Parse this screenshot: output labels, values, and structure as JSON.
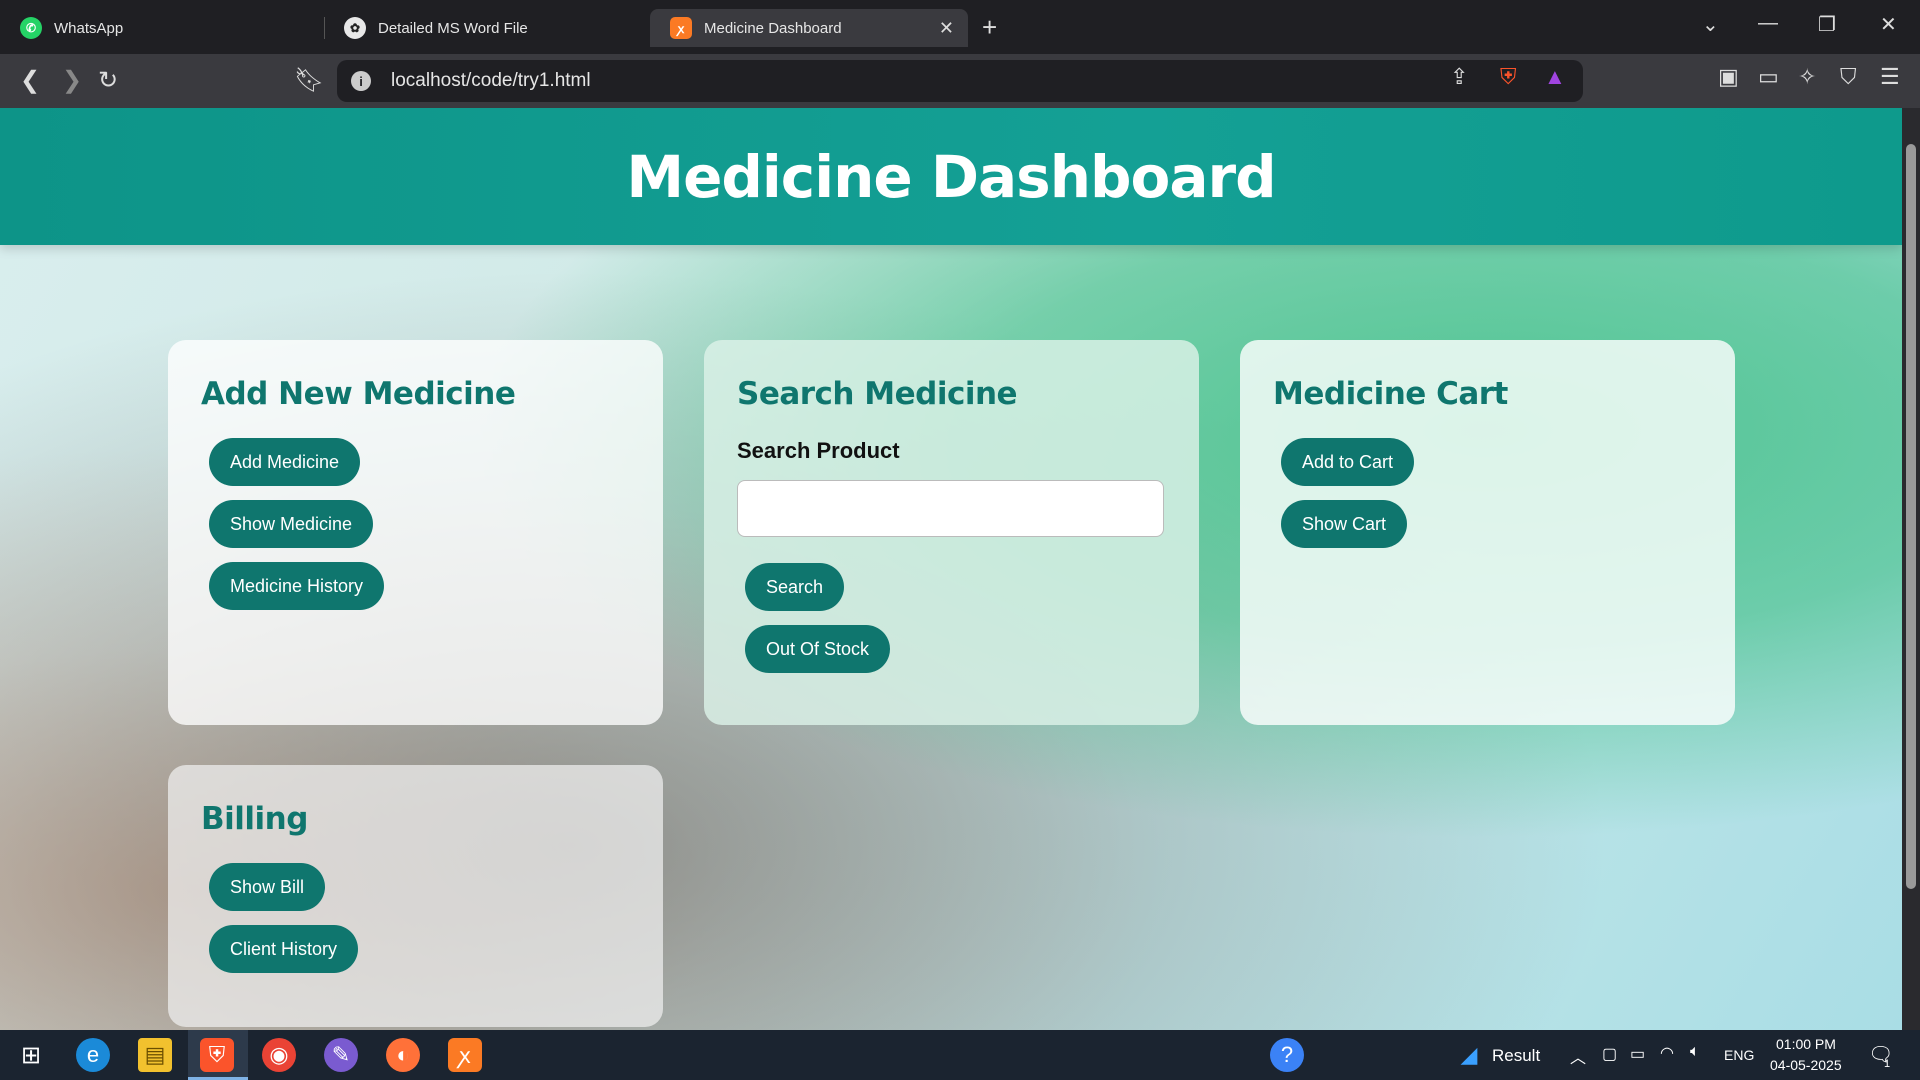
{
  "browser": {
    "tabs": [
      {
        "label": "WhatsApp",
        "icon": "whatsapp-icon"
      },
      {
        "label": "Detailed MS Word File",
        "icon": "openai-icon"
      },
      {
        "label": "Medicine Dashboard",
        "icon": "xampp-icon",
        "active": true
      }
    ],
    "url": "localhost/code/try1.html"
  },
  "page": {
    "title": "Medicine Dashboard",
    "cards": {
      "add": {
        "title": "Add New Medicine",
        "buttons": [
          "Add Medicine",
          "Show Medicine",
          "Medicine History"
        ]
      },
      "search": {
        "title": "Search Medicine",
        "field_label": "Search Product",
        "input_value": "",
        "buttons": [
          "Search",
          "Out Of Stock"
        ]
      },
      "cart": {
        "title": "Medicine Cart",
        "buttons": [
          "Add to Cart",
          "Show Cart"
        ]
      },
      "billing": {
        "title": "Billing",
        "buttons": [
          "Show Bill",
          "Client History"
        ]
      }
    }
  },
  "taskbar": {
    "weather_label": "Result",
    "language": "ENG",
    "time": "01:00 PM",
    "date": "04-05-2025",
    "notification_count": "1"
  },
  "colors": {
    "header": "#0d9488",
    "card_title": "#0f766e",
    "button": "#0f766e"
  }
}
